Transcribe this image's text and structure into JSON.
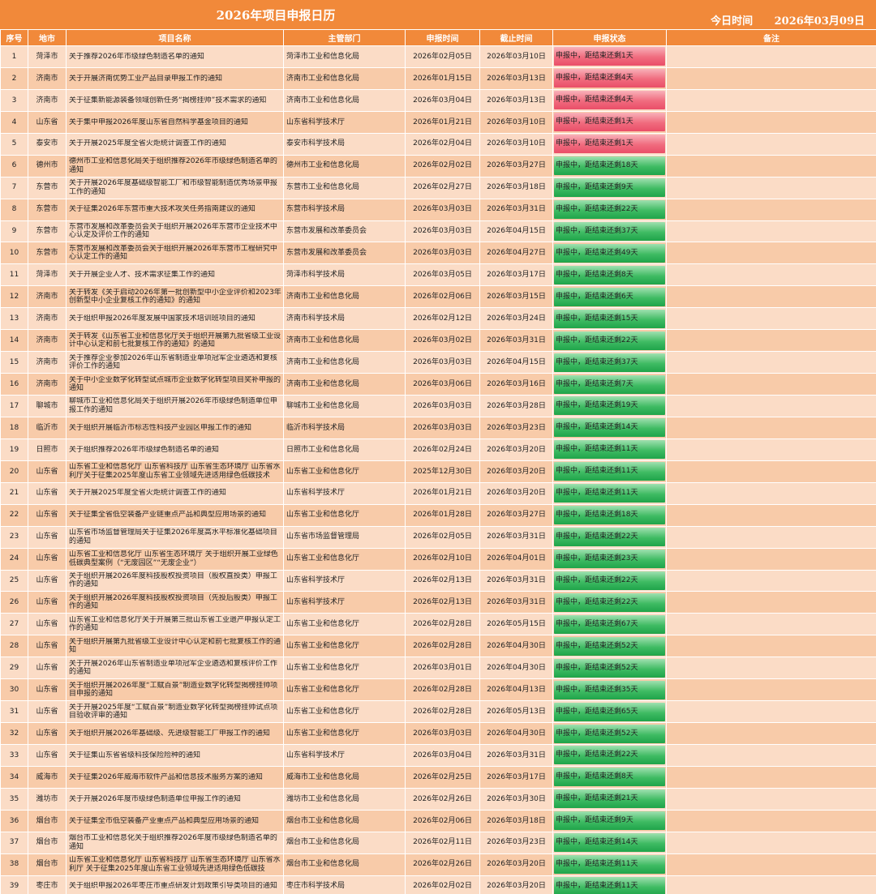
{
  "title": "2026年项目申报日历",
  "today_label": "今日时间",
  "today_value": "2026年03月09日",
  "colors": {
    "header": "#f1893a",
    "row_light": "#fbdcc6",
    "row_dark": "#f8cba9",
    "urgent": "#ea4e68",
    "normal": "#1fa44a"
  },
  "headers": [
    "序号",
    "地市",
    "项目名称",
    "主管部门",
    "申报时间",
    "截止时间",
    "申报状态",
    "备注"
  ],
  "rows": [
    {
      "no": "1",
      "city": "菏泽市",
      "name": "关于推荐2026年市级绿色制造名单的通知",
      "dept": "菏泽市工业和信息化局",
      "start": "2026年02月05日",
      "end": "2026年03月10日",
      "status": "申报中，距结束还剩1天",
      "level": "red",
      "note": ""
    },
    {
      "no": "2",
      "city": "济南市",
      "name": "关于开展济南优势工业产品目录申报工作的通知",
      "dept": "济南市工业和信息化局",
      "start": "2026年01月15日",
      "end": "2026年03月13日",
      "status": "申报中，距结束还剩4天",
      "level": "red",
      "note": ""
    },
    {
      "no": "3",
      "city": "济南市",
      "name": "关于征集新能源装备领域创新任务“揭榜挂帅”技术需求的通知",
      "dept": "济南市工业和信息化局",
      "start": "2026年03月04日",
      "end": "2026年03月13日",
      "status": "申报中，距结束还剩4天",
      "level": "red",
      "note": ""
    },
    {
      "no": "4",
      "city": "山东省",
      "name": "关于集中申报2026年度山东省自然科学基金项目的通知",
      "dept": "山东省科学技术厅",
      "start": "2026年01月21日",
      "end": "2026年03月10日",
      "status": "申报中，距结束还剩1天",
      "level": "red",
      "note": ""
    },
    {
      "no": "5",
      "city": "泰安市",
      "name": "关于开展2025年度全省火炬统计调查工作的通知",
      "dept": "泰安市科学技术局",
      "start": "2026年02月04日",
      "end": "2026年03月10日",
      "status": "申报中，距结束还剩1天",
      "level": "red",
      "note": ""
    },
    {
      "no": "6",
      "city": "德州市",
      "name": "德州市工业和信息化局关于组织推荐2026年市级绿色制造名单的通知",
      "dept": "德州市工业和信息化局",
      "start": "2026年02月02日",
      "end": "2026年03月27日",
      "status": "申报中，距结束还剩18天",
      "level": "green",
      "note": ""
    },
    {
      "no": "7",
      "city": "东营市",
      "name": "关于开展2026年度基础级智能工厂和市级智能制造优秀场景申报工作的通知",
      "dept": "东营市工业和信息化局",
      "start": "2026年02月27日",
      "end": "2026年03月18日",
      "status": "申报中，距结束还剩9天",
      "level": "green",
      "note": ""
    },
    {
      "no": "8",
      "city": "东营市",
      "name": "关于征集2026年东营市重大技术攻关任务指南建议的通知",
      "dept": "东营市科学技术局",
      "start": "2026年03月03日",
      "end": "2026年03月31日",
      "status": "申报中，距结束还剩22天",
      "level": "green",
      "note": ""
    },
    {
      "no": "9",
      "city": "东营市",
      "name": "东营市发展和改革委员会关于组织开展2026年东营市企业技术中心认定及评价工作的通知",
      "dept": "东营市发展和改革委员会",
      "start": "2026年03月03日",
      "end": "2026年04月15日",
      "status": "申报中，距结束还剩37天",
      "level": "green",
      "note": ""
    },
    {
      "no": "10",
      "city": "东营市",
      "name": "东营市发展和改革委员会关于组织开展2026年东营市工程研究中心认定工作的通知",
      "dept": "东营市发展和改革委员会",
      "start": "2026年03月03日",
      "end": "2026年04月27日",
      "status": "申报中，距结束还剩49天",
      "level": "green",
      "note": ""
    },
    {
      "no": "11",
      "city": "菏泽市",
      "name": "关于开展企业人才、技术需求征集工作的通知",
      "dept": "菏泽市科学技术局",
      "start": "2026年03月05日",
      "end": "2026年03月17日",
      "status": "申报中，距结束还剩8天",
      "level": "green",
      "note": ""
    },
    {
      "no": "12",
      "city": "济南市",
      "name": "关于转发《关于启动2026年第一批创新型中小企业评价和2023年创新型中小企业复核工作的通知》的通知",
      "dept": "济南市工业和信息化局",
      "start": "2026年02月06日",
      "end": "2026年03月15日",
      "status": "申报中，距结束还剩6天",
      "level": "green",
      "note": ""
    },
    {
      "no": "13",
      "city": "济南市",
      "name": "关于组织申报2026年度发展中国家技术培训班项目的通知",
      "dept": "济南市科学技术局",
      "start": "2026年02月12日",
      "end": "2026年03月24日",
      "status": "申报中，距结束还剩15天",
      "level": "green",
      "note": ""
    },
    {
      "no": "14",
      "city": "济南市",
      "name": "关于转发《山东省工业和信息化厅关于组织开展第九批省级工业设计中心认定和前七批复核工作的通知》的通知",
      "dept": "济南市工业和信息化局",
      "start": "2026年03月02日",
      "end": "2026年03月31日",
      "status": "申报中，距结束还剩22天",
      "level": "green",
      "note": ""
    },
    {
      "no": "15",
      "city": "济南市",
      "name": "关于推荐企业参加2026年山东省制造业单项冠军企业遴选和复核评价工作的通知",
      "dept": "济南市工业和信息化局",
      "start": "2026年03月03日",
      "end": "2026年04月15日",
      "status": "申报中，距结束还剩37天",
      "level": "green",
      "note": ""
    },
    {
      "no": "16",
      "city": "济南市",
      "name": "关于中小企业数字化转型试点城市企业数字化转型项目奖补申报的通知",
      "dept": "济南市工业和信息化局",
      "start": "2026年03月06日",
      "end": "2026年03月16日",
      "status": "申报中，距结束还剩7天",
      "level": "green",
      "note": ""
    },
    {
      "no": "17",
      "city": "聊城市",
      "name": "聊城市工业和信息化局关于组织开展2026年市级绿色制造单位申报工作的通知",
      "dept": "聊城市工业和信息化局",
      "start": "2026年03月03日",
      "end": "2026年03月28日",
      "status": "申报中，距结束还剩19天",
      "level": "green",
      "note": ""
    },
    {
      "no": "18",
      "city": "临沂市",
      "name": "关于组织开展临沂市标志性科技产业园区申报工作的通知",
      "dept": "临沂市科学技术局",
      "start": "2026年03月03日",
      "end": "2026年03月23日",
      "status": "申报中，距结束还剩14天",
      "level": "green",
      "note": ""
    },
    {
      "no": "19",
      "city": "日照市",
      "name": "关于组织推荐2026年市级绿色制造名单的通知",
      "dept": "日照市工业和信息化局",
      "start": "2026年02月24日",
      "end": "2026年03月20日",
      "status": "申报中，距结束还剩11天",
      "level": "green",
      "note": ""
    },
    {
      "no": "20",
      "city": "山东省",
      "name": "山东省工业和信息化厅 山东省科技厅 山东省生态环境厅 山东省水利厅关于征集2025年度山东省工业领域先进适用绿色低碳技术",
      "dept": "山东省工业和信息化厅",
      "start": "2025年12月30日",
      "end": "2026年03月20日",
      "status": "申报中，距结束还剩11天",
      "level": "green",
      "note": ""
    },
    {
      "no": "21",
      "city": "山东省",
      "name": "关于开展2025年度全省火炬统计调查工作的通知",
      "dept": "山东省科学技术厅",
      "start": "2026年01月21日",
      "end": "2026年03月20日",
      "status": "申报中，距结束还剩11天",
      "level": "green",
      "note": ""
    },
    {
      "no": "22",
      "city": "山东省",
      "name": "关于征集全省低空装备产业链重点产品和典型应用场景的通知",
      "dept": "山东省工业和信息化厅",
      "start": "2026年01月28日",
      "end": "2026年03月27日",
      "status": "申报中，距结束还剩18天",
      "level": "green",
      "note": ""
    },
    {
      "no": "23",
      "city": "山东省",
      "name": "山东省市场监督管理局关于征集2026年度高水平标准化基础项目的通知",
      "dept": "山东省市场监督管理局",
      "start": "2026年02月05日",
      "end": "2026年03月31日",
      "status": "申报中，距结束还剩22天",
      "level": "green",
      "note": ""
    },
    {
      "no": "24",
      "city": "山东省",
      "name": "山东省工业和信息化厅 山东省生态环境厅 关于组织开展工业绿色低碳典型案例（“无废园区”“无废企业”）",
      "dept": "山东省工业和信息化厅",
      "start": "2026年02月10日",
      "end": "2026年04月01日",
      "status": "申报中，距结束还剩23天",
      "level": "green",
      "note": ""
    },
    {
      "no": "25",
      "city": "山东省",
      "name": "关于组织开展2026年度科技股权投资项目（股权直投类）申报工作的通知",
      "dept": "山东省科学技术厅",
      "start": "2026年02月13日",
      "end": "2026年03月31日",
      "status": "申报中，距结束还剩22天",
      "level": "green",
      "note": ""
    },
    {
      "no": "26",
      "city": "山东省",
      "name": "关于组织开展2026年度科技股权投资项目（先投后股类）申报工作的通知",
      "dept": "山东省科学技术厅",
      "start": "2026年02月13日",
      "end": "2026年03月31日",
      "status": "申报中，距结束还剩22天",
      "level": "green",
      "note": ""
    },
    {
      "no": "27",
      "city": "山东省",
      "name": "山东省工业和信息化厅关于开展第三批山东省工业遗产申报认定工作的通知",
      "dept": "山东省工业和信息化厅",
      "start": "2026年02月28日",
      "end": "2026年05月15日",
      "status": "申报中，距结束还剩67天",
      "level": "green",
      "note": ""
    },
    {
      "no": "28",
      "city": "山东省",
      "name": "关于组织开展第九批省级工业设计中心认定和前七批复核工作的通知",
      "dept": "山东省工业和信息化厅",
      "start": "2026年02月28日",
      "end": "2026年04月30日",
      "status": "申报中，距结束还剩52天",
      "level": "green",
      "note": ""
    },
    {
      "no": "29",
      "city": "山东省",
      "name": "关于开展2026年山东省制造业单项冠军企业遴选和复核评价工作的通知",
      "dept": "山东省工业和信息化厅",
      "start": "2026年03月01日",
      "end": "2026年04月30日",
      "status": "申报中，距结束还剩52天",
      "level": "green",
      "note": ""
    },
    {
      "no": "30",
      "city": "山东省",
      "name": "关于组织开展2026年度“工赋百景”制造业数字化转型揭榜挂帅项目申报的通知",
      "dept": "山东省工业和信息化厅",
      "start": "2026年02月28日",
      "end": "2026年04月13日",
      "status": "申报中，距结束还剩35天",
      "level": "green",
      "note": ""
    },
    {
      "no": "31",
      "city": "山东省",
      "name": "关于开展2025年度“工赋百景”制造业数字化转型揭榜挂帅试点项目验收评审的通知",
      "dept": "山东省工业和信息化厅",
      "start": "2026年02月28日",
      "end": "2026年05月13日",
      "status": "申报中，距结束还剩65天",
      "level": "green",
      "note": ""
    },
    {
      "no": "32",
      "city": "山东省",
      "name": "关于组织开展2026年基础级、先进级智能工厂申报工作的通知",
      "dept": "山东省工业和信息化厅",
      "start": "2026年03月03日",
      "end": "2026年04月30日",
      "status": "申报中，距结束还剩52天",
      "level": "green",
      "note": ""
    },
    {
      "no": "33",
      "city": "山东省",
      "name": "关于征集山东省省级科技保险险种的通知",
      "dept": "山东省科学技术厅",
      "start": "2026年03月04日",
      "end": "2026年03月31日",
      "status": "申报中，距结束还剩22天",
      "level": "green",
      "note": ""
    },
    {
      "no": "34",
      "city": "威海市",
      "name": "关于征集2026年威海市软件产品和信息技术服务方案的通知",
      "dept": "威海市工业和信息化局",
      "start": "2026年02月25日",
      "end": "2026年03月17日",
      "status": "申报中，距结束还剩8天",
      "level": "green",
      "note": ""
    },
    {
      "no": "35",
      "city": "潍坊市",
      "name": "关于开展2026年度市级绿色制造单位申报工作的通知",
      "dept": "潍坊市工业和信息化局",
      "start": "2026年02月26日",
      "end": "2026年03月30日",
      "status": "申报中，距结束还剩21天",
      "level": "green",
      "note": ""
    },
    {
      "no": "36",
      "city": "烟台市",
      "name": "关于征集全市低空装备产业重点产品和典型应用场景的通知",
      "dept": "烟台市工业和信息化局",
      "start": "2026年02月06日",
      "end": "2026年03月18日",
      "status": "申报中，距结束还剩9天",
      "level": "green",
      "note": ""
    },
    {
      "no": "37",
      "city": "烟台市",
      "name": "烟台市工业和信息化关于组织推荐2026年度市级绿色制造名单的通知",
      "dept": "烟台市工业和信息化局",
      "start": "2026年02月11日",
      "end": "2026年03月23日",
      "status": "申报中，距结束还剩14天",
      "level": "green",
      "note": ""
    },
    {
      "no": "38",
      "city": "烟台市",
      "name": "山东省工业和信息化厅 山东省科技厅 山东省生态环境厅 山东省水利厅 关于征集2025年度山东省工业领域先进适用绿色低碳技",
      "dept": "烟台市工业和信息化局",
      "start": "2026年02月26日",
      "end": "2026年03月20日",
      "status": "申报中，距结束还剩11天",
      "level": "green",
      "note": ""
    },
    {
      "no": "39",
      "city": "枣庄市",
      "name": "关于组织申报2026年枣庄市重点研发计划政策引导类项目的通知",
      "dept": "枣庄市科学技术局",
      "start": "2026年02月02日",
      "end": "2026年03月20日",
      "status": "申报中，距结束还剩11天",
      "level": "green",
      "note": ""
    }
  ]
}
